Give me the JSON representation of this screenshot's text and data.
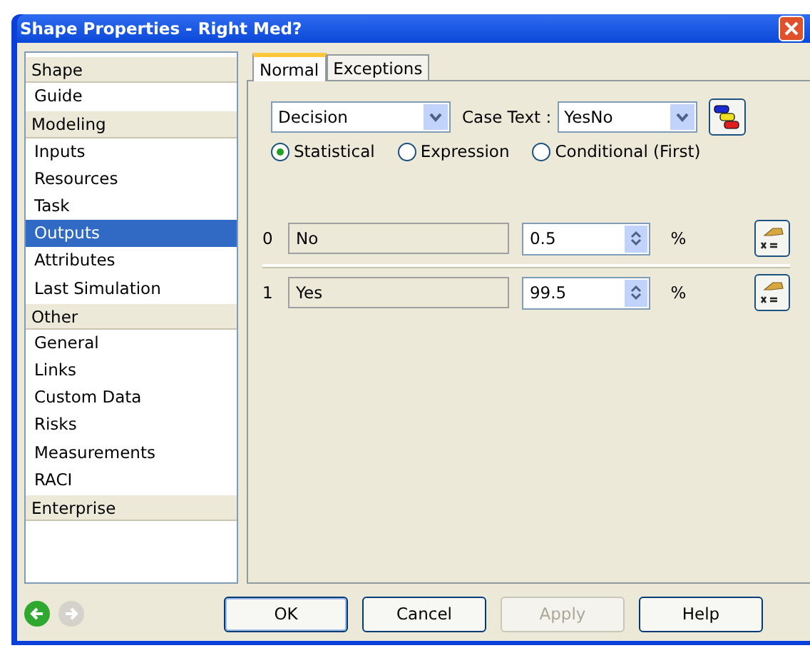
{
  "window": {
    "title": "Shape Properties - Right Med?"
  },
  "sidebar": {
    "items": [
      {
        "label": "Shape",
        "kind": "header",
        "selected": false
      },
      {
        "label": "Guide",
        "kind": "item",
        "selected": false
      },
      {
        "label": "Modeling",
        "kind": "header",
        "selected": false
      },
      {
        "label": "Inputs",
        "kind": "item",
        "selected": false
      },
      {
        "label": "Resources",
        "kind": "item",
        "selected": false
      },
      {
        "label": "Task",
        "kind": "item",
        "selected": false
      },
      {
        "label": "Outputs",
        "kind": "item",
        "selected": true
      },
      {
        "label": "Attributes",
        "kind": "item",
        "selected": false
      },
      {
        "label": "Last Simulation",
        "kind": "item",
        "selected": false
      },
      {
        "label": "Other",
        "kind": "header",
        "selected": false
      },
      {
        "label": "General",
        "kind": "item",
        "selected": false
      },
      {
        "label": "Links",
        "kind": "item",
        "selected": false
      },
      {
        "label": "Custom Data",
        "kind": "item",
        "selected": false
      },
      {
        "label": "Risks",
        "kind": "item",
        "selected": false
      },
      {
        "label": "Measurements",
        "kind": "item",
        "selected": false
      },
      {
        "label": "RACI",
        "kind": "item",
        "selected": false
      },
      {
        "label": "Enterprise",
        "kind": "header",
        "selected": false
      }
    ]
  },
  "tabs": [
    {
      "label": "Normal",
      "selected": true
    },
    {
      "label": "Exceptions",
      "selected": false
    }
  ],
  "type_select": {
    "value": "Decision"
  },
  "case_text": {
    "label": "Case Text :",
    "value": "YesNo"
  },
  "modes": [
    {
      "label": "Statistical",
      "selected": true
    },
    {
      "label": "Expression",
      "selected": false
    },
    {
      "label": "Conditional (First)",
      "selected": false
    }
  ],
  "outputs": [
    {
      "index": "0",
      "name": "No",
      "value": "0.5",
      "unit": "%"
    },
    {
      "index": "1",
      "name": "Yes",
      "value": "99.5",
      "unit": "%"
    }
  ],
  "buttons": [
    {
      "label": "OK",
      "disabled": false,
      "default": true
    },
    {
      "label": "Cancel",
      "disabled": false,
      "default": false
    },
    {
      "label": "Apply",
      "disabled": true,
      "default": false
    },
    {
      "label": "Help",
      "disabled": false,
      "default": false
    }
  ],
  "nav": {
    "back_disabled": false,
    "forward_disabled": true
  }
}
